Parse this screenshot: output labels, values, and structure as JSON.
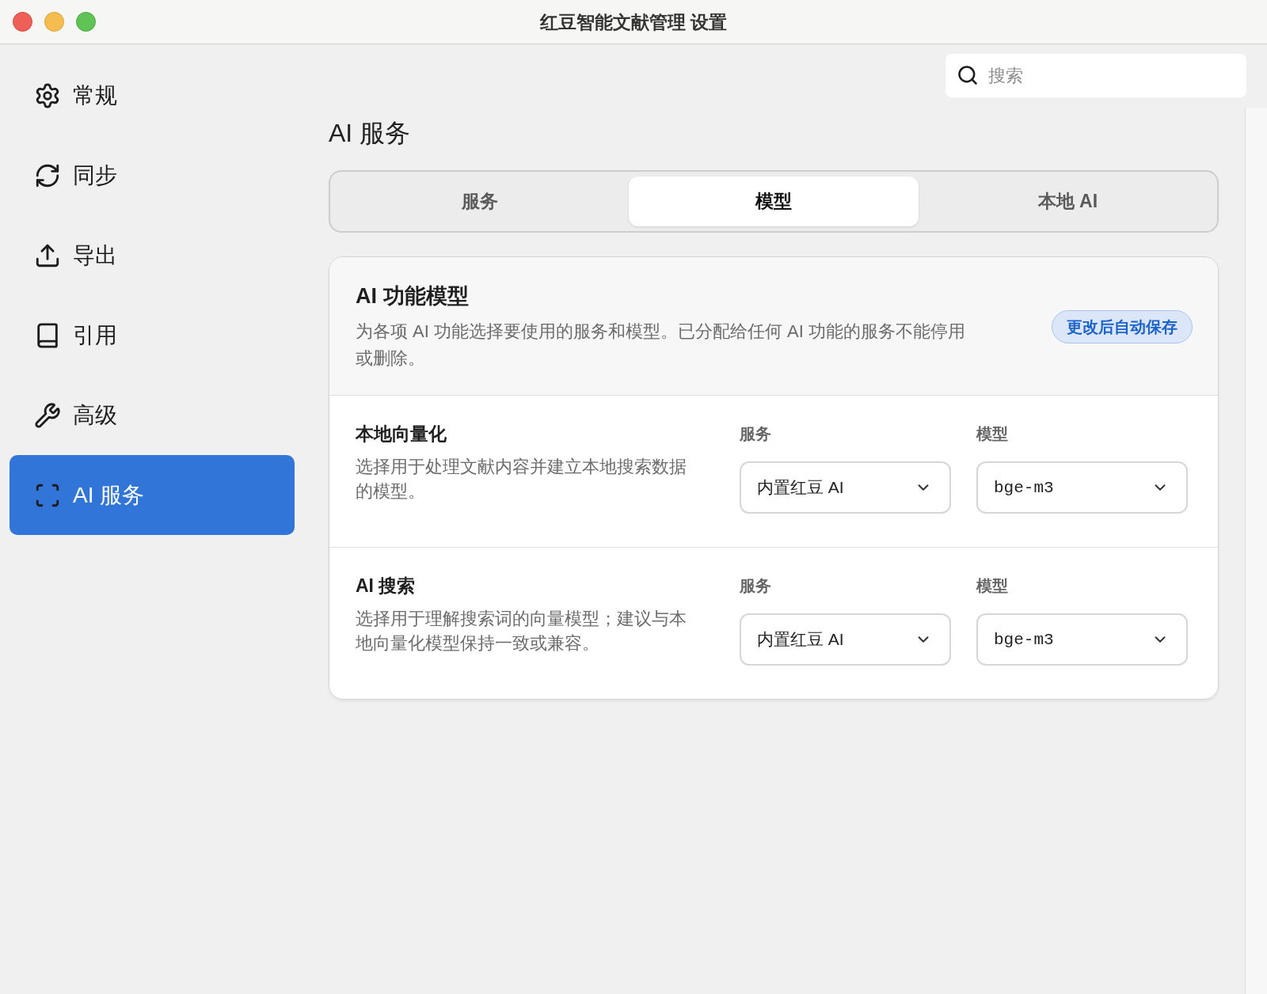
{
  "window": {
    "title": "红豆智能文献管理 设置"
  },
  "sidebar": {
    "items": [
      {
        "label": "常规",
        "selected": false
      },
      {
        "label": "同步",
        "selected": false
      },
      {
        "label": "导出",
        "selected": false
      },
      {
        "label": "引用",
        "selected": false
      },
      {
        "label": "高级",
        "selected": false
      },
      {
        "label": "AI 服务",
        "selected": true
      }
    ]
  },
  "search": {
    "placeholder": "搜索"
  },
  "page": {
    "title": "AI 服务"
  },
  "tabs": [
    {
      "label": "服务",
      "selected": false
    },
    {
      "label": "模型",
      "selected": true
    },
    {
      "label": "本地 AI",
      "selected": false
    }
  ],
  "card": {
    "title": "AI 功能模型",
    "description": "为各项 AI 功能选择要使用的服务和模型。已分配给任何 AI 功能的服务不能停用或删除。",
    "badge": "更改后自动保存",
    "rows": [
      {
        "title": "本地向量化",
        "description": "选择用于处理文献内容并建立本地搜索数据的模型。",
        "service_label": "服务",
        "service": "内置红豆 AI",
        "model_label": "模型",
        "model": "bge-m3"
      },
      {
        "title": "AI 搜索",
        "description": "选择用于理解搜索词的向量模型；建议与本地向量化模型保持一致或兼容。",
        "service_label": "服务",
        "service": "内置红豆 AI",
        "model_label": "模型",
        "model": "bge-m3"
      }
    ]
  }
}
